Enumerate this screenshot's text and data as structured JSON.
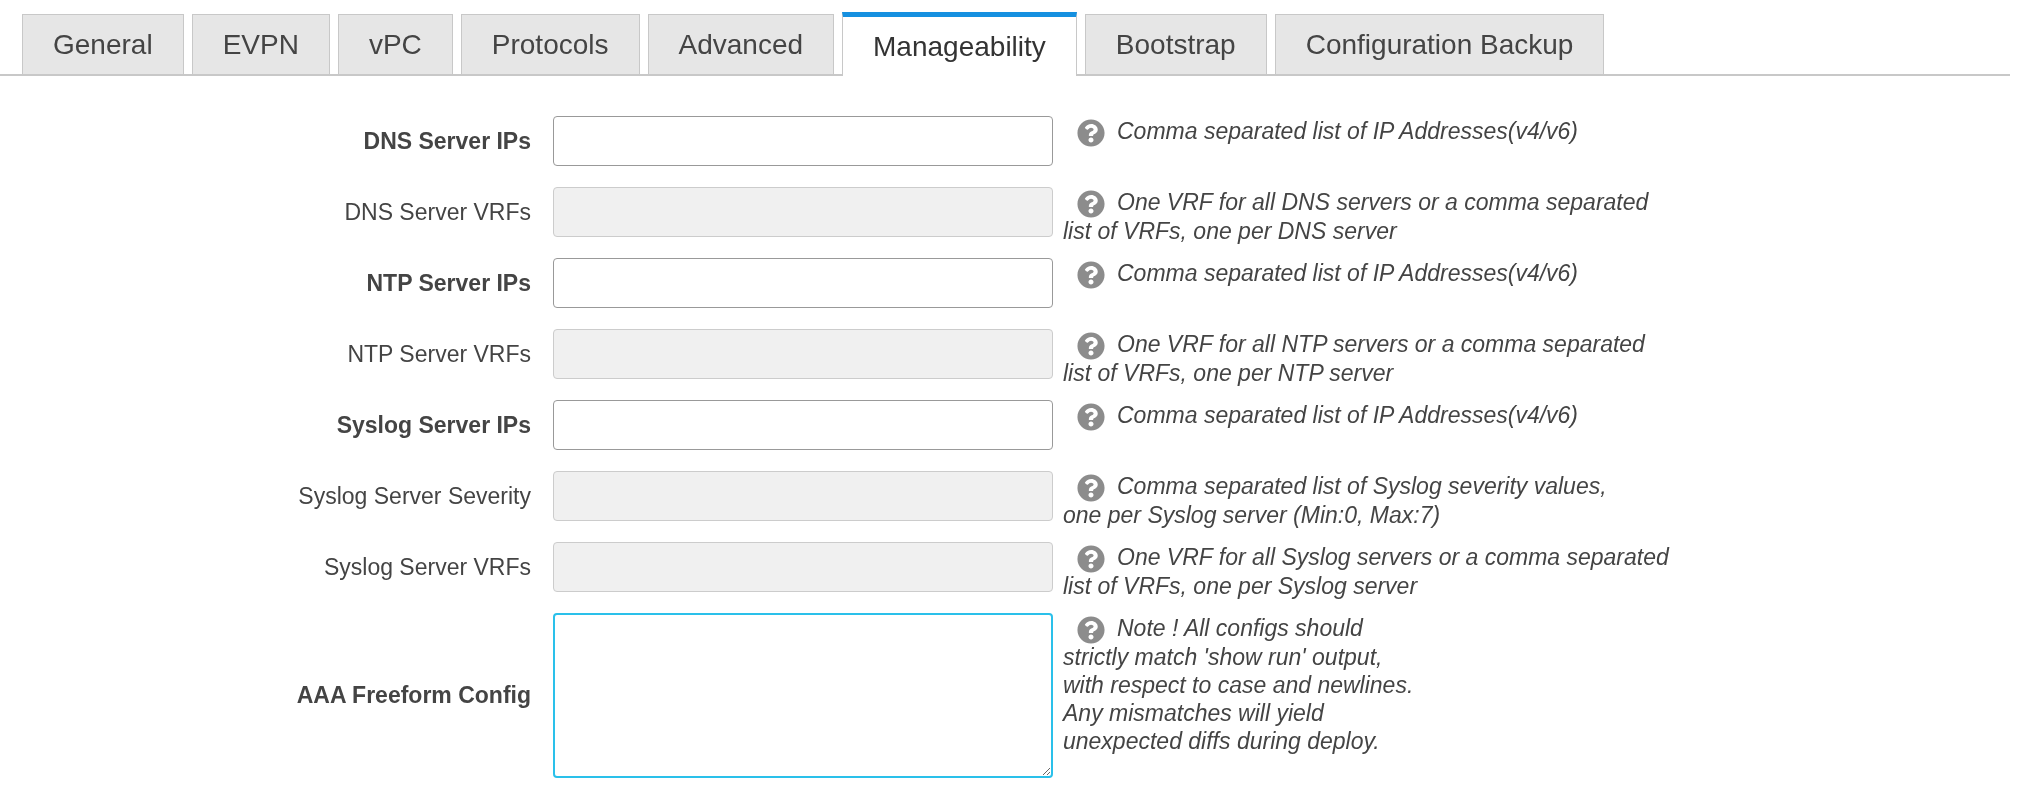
{
  "tabs": [
    {
      "label": "General",
      "selected": false
    },
    {
      "label": "EVPN",
      "selected": false
    },
    {
      "label": "vPC",
      "selected": false
    },
    {
      "label": "Protocols",
      "selected": false
    },
    {
      "label": "Advanced",
      "selected": false
    },
    {
      "label": "Manageability",
      "selected": true
    },
    {
      "label": "Bootstrap",
      "selected": false
    },
    {
      "label": "Configuration Backup",
      "selected": false
    }
  ],
  "fields": [
    {
      "label": "DNS Server IPs",
      "required": true,
      "kind": "input",
      "disabled": false,
      "help": "Comma separated list of IP Addresses(v4/v6)"
    },
    {
      "label": "DNS Server VRFs",
      "required": false,
      "kind": "input",
      "disabled": true,
      "help": "One VRF for all DNS servers or a comma separated\nlist of VRFs, one per DNS server"
    },
    {
      "label": "NTP Server IPs",
      "required": true,
      "kind": "input",
      "disabled": false,
      "help": "Comma separated list of IP Addresses(v4/v6)"
    },
    {
      "label": "NTP Server VRFs",
      "required": false,
      "kind": "input",
      "disabled": true,
      "help": "One VRF for all NTP servers or a comma separated\nlist of VRFs, one per NTP server"
    },
    {
      "label": "Syslog Server IPs",
      "required": true,
      "kind": "input",
      "disabled": false,
      "help": "Comma separated list of IP Addresses(v4/v6)"
    },
    {
      "label": "Syslog Server Severity",
      "required": false,
      "kind": "input",
      "disabled": true,
      "help": "Comma separated list of Syslog severity values,\none per Syslog server (Min:0, Max:7)"
    },
    {
      "label": "Syslog Server VRFs",
      "required": false,
      "kind": "input",
      "disabled": true,
      "help": "One VRF for all Syslog servers or a comma separated\nlist of VRFs, one per Syslog server"
    },
    {
      "label": "AAA Freeform Config",
      "required": true,
      "kind": "textarea",
      "disabled": false,
      "focused": true,
      "help": "Note ! All configs should\nstrictly match 'show run' output,\nwith respect to case and newlines.\nAny mismatches will yield\nunexpected diffs during deploy."
    }
  ]
}
